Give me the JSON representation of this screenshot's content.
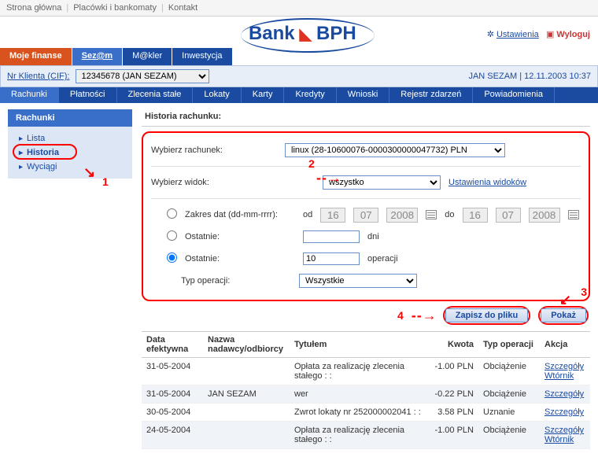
{
  "topbar": {
    "home": "Strona główna",
    "branches": "Placówki i bankomaty",
    "contact": "Kontakt"
  },
  "logo": {
    "bank": "Bank",
    "bph": "BPH"
  },
  "settings": {
    "label": "Ustawienia",
    "logout": "Wyloguj"
  },
  "tabs1": {
    "moje": "Moje finanse",
    "sezam": "Sez@m",
    "makler": "M@kler",
    "inwest": "Inwestycja"
  },
  "cif": {
    "label": "Nr Klienta (CIF):",
    "selected": "12345678 (JAN SEZAM)",
    "user": "JAN SEZAM | 12.11.2003 10:37"
  },
  "tabs2": [
    "Rachunki",
    "Płatności",
    "Zlecenia stałe",
    "Lokaty",
    "Karty",
    "Kredyty",
    "Wnioski",
    "Rejestr zdarzeń",
    "Powiadomienia"
  ],
  "sidebar": {
    "head": "Rachunki",
    "items": [
      "Lista",
      "Historia",
      "Wyciągi"
    ],
    "activeIndex": 1
  },
  "section": {
    "title": "Historia rachunku:"
  },
  "form": {
    "accountLabel": "Wybierz rachunek:",
    "accountSelected": "linux (28-10600076-0000300000047732) PLN",
    "viewLabel": "Wybierz widok:",
    "viewSelected": "wszystko",
    "viewSettings": "Ustawienia widoków",
    "rangeLabel": "Zakres dat (dd-mm-rrrr):",
    "lastLabel1": "Ostatnie:",
    "lastLabel2": "Ostatnie:",
    "dateFromLabel": "od",
    "dateToLabel": "do",
    "d1": "16",
    "m1": "07",
    "y1": "2008",
    "d2": "16",
    "m2": "07",
    "y2": "2008",
    "daysUnit": "dni",
    "opsValue": "10",
    "opsUnit": "operacji",
    "typeLabel": "Typ operacji:",
    "typeSelected": "Wszystkie"
  },
  "buttons": {
    "save": "Zapisz do pliku",
    "show": "Pokaż"
  },
  "table": {
    "headers": {
      "date": "Data efektywna",
      "name": "Nazwa nadawcy/odbiorcy",
      "title": "Tytułem",
      "amount": "Kwota",
      "type": "Typ operacji",
      "action": "Akcja"
    },
    "rows": [
      {
        "date": "31-05-2004",
        "name": "",
        "title": "Opłata za realizację zlecenia stałego : :",
        "amount": "-1.00 PLN",
        "type": "Obciążenie",
        "actions": [
          "Szczegóły",
          "Wtórnik"
        ]
      },
      {
        "date": "31-05-2004",
        "name": "JAN SEZAM",
        "title": "wer",
        "amount": "-0.22 PLN",
        "type": "Obciążenie",
        "actions": [
          "Szczegóły"
        ]
      },
      {
        "date": "30-05-2004",
        "name": "",
        "title": "Zwrot lokaty nr 252000002041 : :",
        "amount": "3.58 PLN",
        "type": "Uznanie",
        "actions": [
          "Szczegóły"
        ]
      },
      {
        "date": "24-05-2004",
        "name": "",
        "title": "Opłata za realizację zlecenia stałego : :",
        "amount": "-1.00 PLN",
        "type": "Obciążenie",
        "actions": [
          "Szczegóły",
          "Wtórnik"
        ]
      }
    ]
  },
  "annotations": {
    "a1": "1",
    "a2": "2",
    "a3": "3",
    "a4": "4"
  }
}
